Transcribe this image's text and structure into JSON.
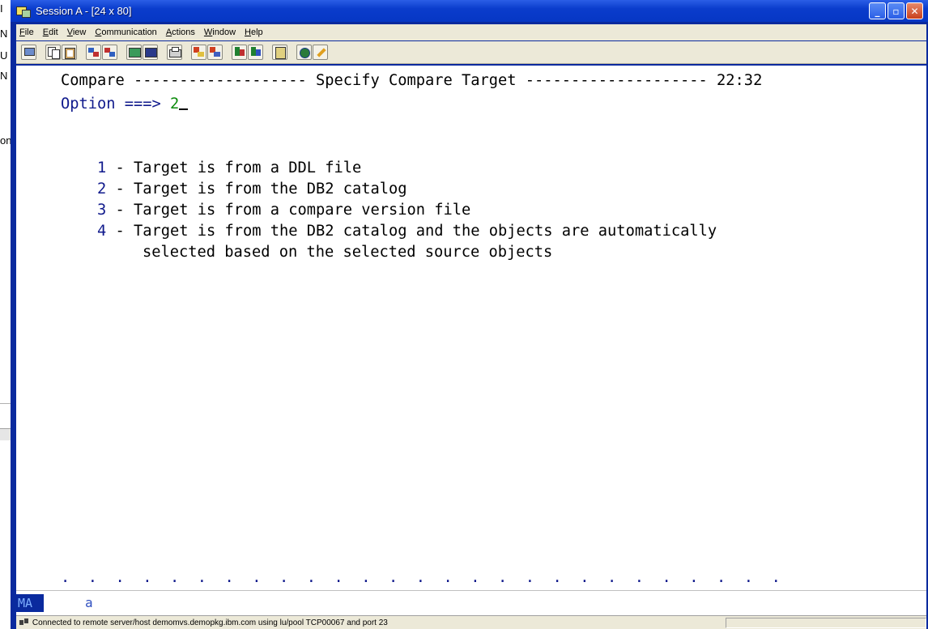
{
  "background_window": {
    "edge_letters": [
      "I",
      "N",
      "U",
      "N",
      "on"
    ]
  },
  "window": {
    "title": "Session A - [24 x 80]",
    "controls": {
      "minimize": "_",
      "maximize": "▫",
      "close": "✕"
    }
  },
  "menu": {
    "items": [
      "File",
      "Edit",
      "View",
      "Communication",
      "Actions",
      "Window",
      "Help"
    ]
  },
  "terminal": {
    "header": "Compare ------------------- Specify Compare Target -------------------- 22:32",
    "option_prompt": "Option ===> ",
    "option_value": "2",
    "options": [
      {
        "num": "1",
        "text": " - Target is from a DDL file"
      },
      {
        "num": "2",
        "text": " - Target is from the DB2 catalog"
      },
      {
        "num": "3",
        "text": " - Target is from a compare version file"
      },
      {
        "num": "4",
        "text": " - Target is from the DB2 catalog and the objects are automatically"
      }
    ],
    "option4_continuation": "    selected based on the selected source objects",
    "dotted_rule": ".  .  .  .  .  .  .  .  .  .  .  .  .  .  .  .  .  .  .  .  .  .  .  .  .  .  ."
  },
  "oia": {
    "mode": "MA",
    "session_letter": "a"
  },
  "status": {
    "text": "Connected to remote server/host demomvs.demopkg.ibm.com using lu/pool TCP00067 and port 23"
  },
  "colors": {
    "window_frame": "#0a2a9e",
    "title_bar": "#0637c4",
    "menu_bg": "#ece9d8",
    "terminal_bg": "#ffffff",
    "option_numbers": "#101a8c",
    "input_value": "#0a8a0a"
  }
}
